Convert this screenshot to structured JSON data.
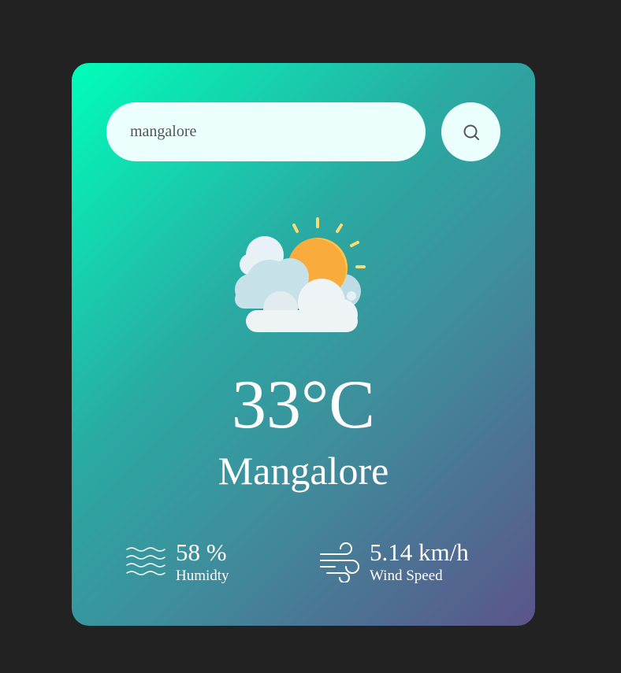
{
  "search": {
    "value": "mangalore",
    "icon": "search-icon"
  },
  "weather": {
    "icon": "partly-cloudy-sun-icon",
    "temperature": "33°C",
    "city": "Mangalore"
  },
  "humidity": {
    "icon": "humidity-waves-icon",
    "value": "58 %",
    "label": "Humidty"
  },
  "wind": {
    "icon": "wind-icon",
    "value": "5.14 km/h",
    "label": "Wind Speed"
  },
  "colors": {
    "background": "#222222",
    "card_gradient_start": "#00feba",
    "card_gradient_end": "#5b548a",
    "input_background": "#ebfffc",
    "text": "#ffffff"
  }
}
